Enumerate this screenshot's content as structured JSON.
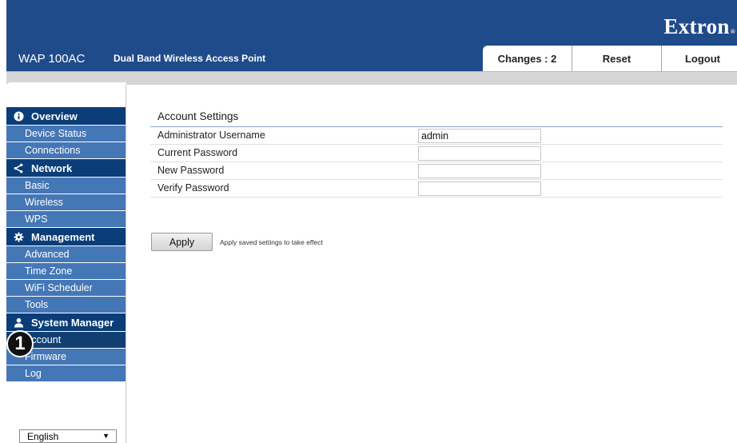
{
  "header": {
    "brand": "Extron",
    "brand_mark": "®",
    "model": "WAP 100AC",
    "subtitle": "Dual Band Wireless Access Point",
    "changes_label": "Changes : 2",
    "reset_label": "Reset",
    "logout_label": "Logout",
    "colors": {
      "header_bg": "#1f4b8a",
      "nav_section": "#0b3d78",
      "nav_item": "#4477b6",
      "nav_active": "#123f73"
    }
  },
  "sidebar": {
    "sections": [
      {
        "label": "Overview",
        "icon": "info-icon",
        "items": [
          "Device Status",
          "Connections"
        ]
      },
      {
        "label": "Network",
        "icon": "share-icon",
        "items": [
          "Basic",
          "Wireless",
          "WPS"
        ]
      },
      {
        "label": "Management",
        "icon": "gear-icon",
        "items": [
          "Advanced",
          "Time Zone",
          "WiFi Scheduler",
          "Tools"
        ]
      },
      {
        "label": "System Manager",
        "icon": "user-icon",
        "items": [
          "Account",
          "Firmware",
          "Log"
        ]
      }
    ],
    "active_item": "Account",
    "language": "English"
  },
  "callout": {
    "number": "1"
  },
  "main": {
    "title": "Account Settings",
    "fields": [
      {
        "label": "Administrator Username",
        "value": "admin"
      },
      {
        "label": "Current Password",
        "value": ""
      },
      {
        "label": "New Password",
        "value": ""
      },
      {
        "label": "Verify Password",
        "value": ""
      }
    ],
    "apply_label": "Apply",
    "apply_hint": "Apply saved settings to take effect"
  }
}
